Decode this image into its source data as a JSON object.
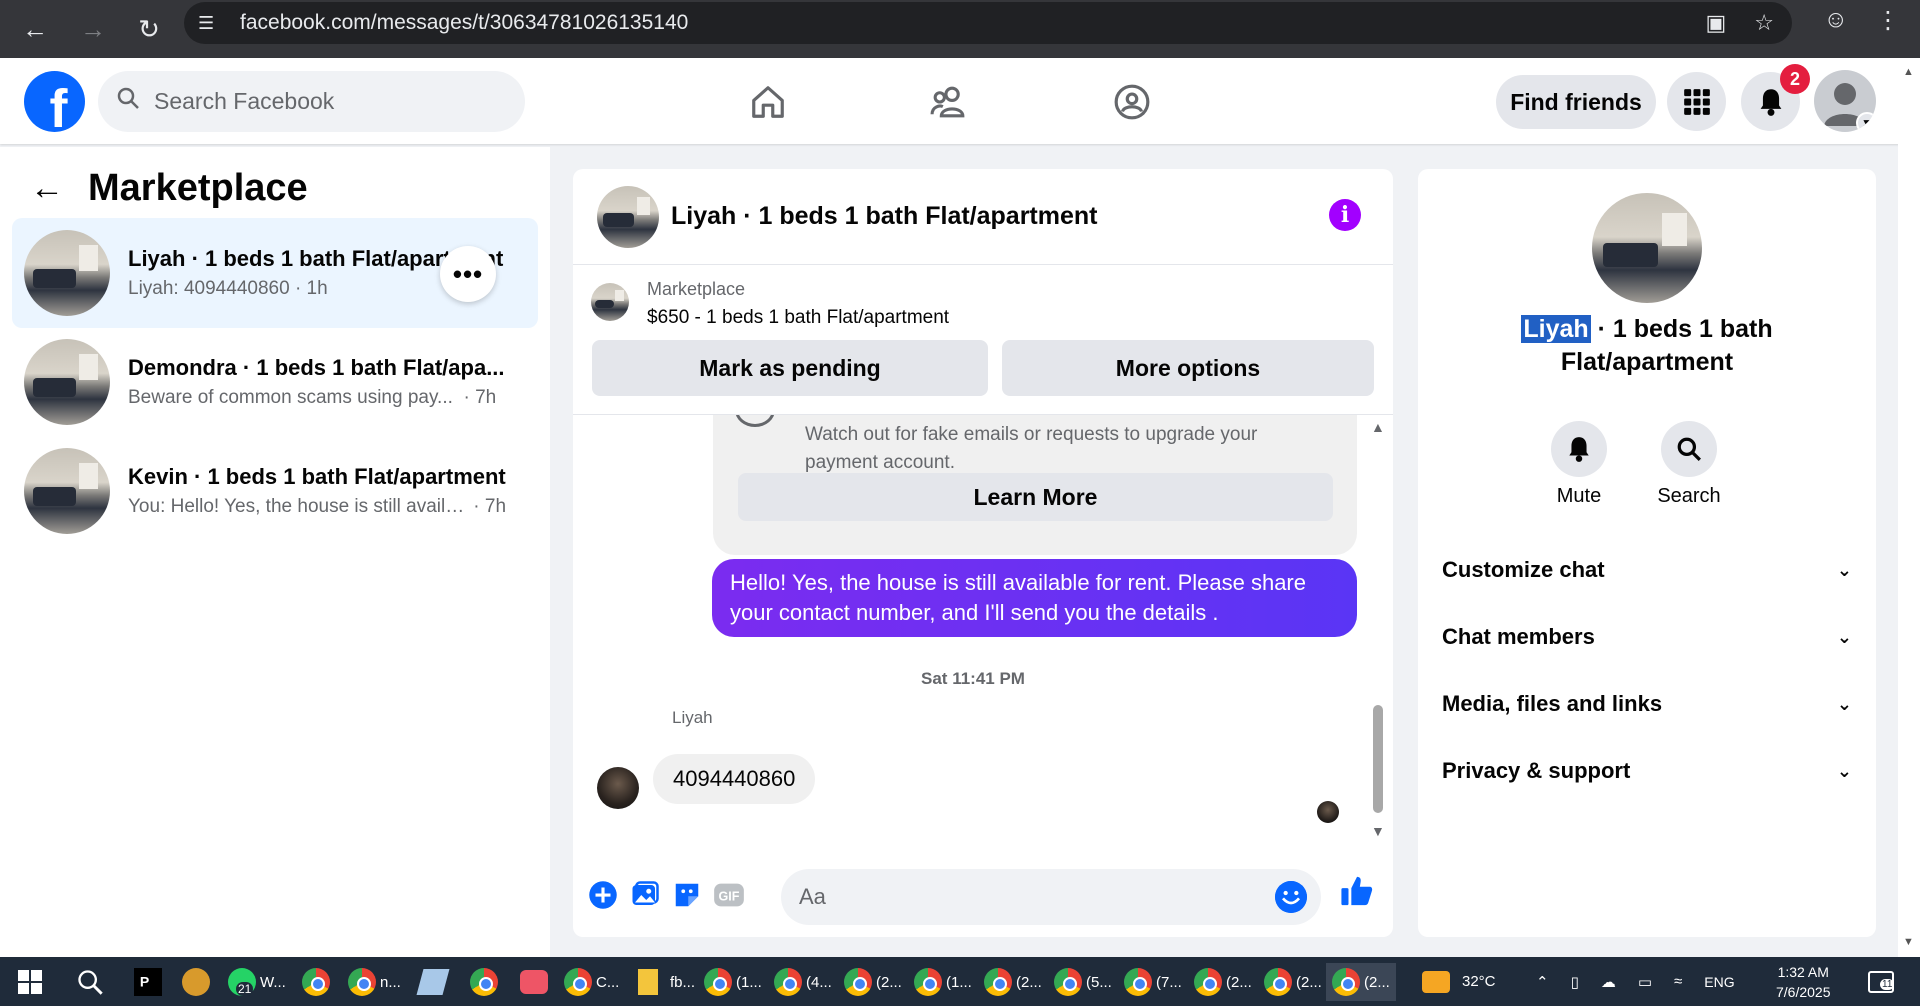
{
  "browser": {
    "url": "facebook.com/messages/t/30634781026135140"
  },
  "header": {
    "search_placeholder": "Search Facebook",
    "find_friends_label": "Find friends",
    "notification_count": "2"
  },
  "sidebar": {
    "title": "Marketplace",
    "conversations": [
      {
        "name": "Liyah · 1 beds 1 bath Flat/apartment",
        "snippet": "Liyah: 4094440860",
        "time": "· 1h"
      },
      {
        "name": "Demondra · 1 beds 1 bath Flat/apa...",
        "snippet": "Beware of common scams using pay...",
        "time": "· 7h"
      },
      {
        "name": "Kevin · 1 beds 1 bath Flat/apartment",
        "snippet": "You: Hello! Yes, the house is still availa...",
        "time": "· 7h"
      }
    ]
  },
  "chat": {
    "title": "Liyah · 1 beds 1 bath Flat/apartment",
    "marketplace_label": "Marketplace",
    "listing": "$650 - 1 beds 1 bath Flat/apartment",
    "mark_pending_label": "Mark as pending",
    "more_options_label": "More options",
    "scam_warning": "Watch out for fake emails or requests to upgrade your payment account.",
    "learn_more_label": "Learn More",
    "outgoing_message": "Hello! Yes, the house is still available for rent. Please share your contact number, and I'll send you the details .",
    "timestamp": "Sat 11:41 PM",
    "sender_name": "Liyah",
    "incoming_message": "4094440860",
    "composer_placeholder": "Aa"
  },
  "details": {
    "name_highlight": "Liyah",
    "title_rest": " · 1 beds 1 bath Flat/apartment",
    "mute_label": "Mute",
    "search_label": "Search",
    "sections": [
      "Customize chat",
      "Chat members",
      "Media, files and links",
      "Privacy & support"
    ]
  },
  "taskbar": {
    "weather": "32°C",
    "language": "ENG",
    "time": "1:32 AM",
    "date": "7/6/2025",
    "notification_count": "11",
    "whatsapp_count": "21",
    "items": [
      "W...",
      "n...",
      "C...",
      "fb...",
      "(1...",
      "(4...",
      "(2...",
      "(1...",
      "(2...",
      "(5...",
      "(7...",
      "(2...",
      "(2...",
      "(2..."
    ]
  },
  "colors": {
    "fb_blue": "#0866ff",
    "message_purple": "#6a2bf2",
    "info_purple": "#a200ff",
    "badge_red": "#e41e3f"
  }
}
